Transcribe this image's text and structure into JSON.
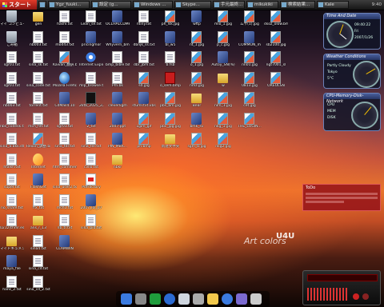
{
  "taskbar": {
    "start_label": "スタート",
    "buttons": [
      "",
      "Ygz_fuuki...",
      "設定 (g...",
      "Windows ...",
      "Skype...",
      "手元最終...",
      "mikukiki",
      "検索結果...",
      "Kale"
    ],
    "clock": "9:40"
  },
  "icons": [
    {
      "label": "マイ コンピュータ",
      "kind": "rec"
    },
    {
      "label": "ごみ箱",
      "kind": "rec"
    },
    {
      "label": "sgr01.txt",
      "kind": "doc"
    },
    {
      "label": "sgr01.txt",
      "kind": "doc"
    },
    {
      "label": "nb003.txt",
      "kind": "doc"
    },
    {
      "label": "nbs_codesk.txt",
      "kind": "doc"
    },
    {
      "label": "sina_a.bkk.stk",
      "kind": "doc"
    },
    {
      "label": "hfalsh.txt",
      "kind": "doc"
    },
    {
      "label": "super.txt",
      "kind": "doc"
    },
    {
      "label": "no_share.txt",
      "kind": "doc"
    },
    {
      "label": "0212(thmr.esp)",
      "kind": "doc"
    },
    {
      "label": "マイドキュメント",
      "kind": "folder"
    },
    {
      "label": "maya_file",
      "kind": "app"
    },
    {
      "label": "hans_2.txt",
      "kind": "doc"
    },
    {
      "label": "gen",
      "kind": "folder"
    },
    {
      "label": "nb003.txt",
      "kind": "doc"
    },
    {
      "label": "sina_sk.txt",
      "kind": "doc"
    },
    {
      "label": "sina_code.txt",
      "kind": "doc"
    },
    {
      "label": "torrent.txt",
      "kind": "doc"
    },
    {
      "label": "mch_fdt.txt",
      "kind": "doc"
    },
    {
      "label": "Rexon_調整.bmp",
      "kind": "img"
    },
    {
      "label": "Internet",
      "kind": "mail"
    },
    {
      "label": "FlashGet",
      "kind": "app"
    },
    {
      "label": "ffx_txt",
      "kind": "doc"
    },
    {
      "label": "ans_r_13",
      "kind": "folder"
    },
    {
      "label": "sina4.txt",
      "kind": "doc"
    },
    {
      "label": "sina_cd.txt",
      "kind": "doc"
    },
    {
      "label": "sina_cd_2.txt",
      "kind": "doc"
    },
    {
      "label": "hashl.txt",
      "kind": "doc"
    },
    {
      "label": "mod43.txt",
      "kind": "doc"
    },
    {
      "label": "Kaivan_翻訳.bmp",
      "kind": "img"
    },
    {
      "label": "Mozilla Firefox",
      "kind": "globe"
    },
    {
      "label": "CdMail4.10",
      "kind": "app"
    },
    {
      "label": "sgr01.txt",
      "kind": "doc"
    },
    {
      "label": "sina_tdr.txt",
      "kind": "doc"
    },
    {
      "label": "hfm_comments",
      "kind": "doc"
    },
    {
      "label": "sina_user2.txt",
      "kind": "doc"
    },
    {
      "label": "mch1.txt",
      "kind": "doc"
    },
    {
      "label": "nb_tr.txt",
      "kind": "doc"
    },
    {
      "label": "CLAMWIN",
      "kind": "app"
    },
    {
      "label": "Lean_se.txt",
      "kind": "doc"
    },
    {
      "label": "pricingmor",
      "kind": "app"
    },
    {
      "label": "Internet Explorer",
      "kind": "ie"
    },
    {
      "label": "mlp_browse.txt",
      "kind": "doc"
    },
    {
      "label": "2ktb_2025_22",
      "kind": "black"
    },
    {
      "label": "2_txt",
      "kind": "app"
    },
    {
      "label": "sina_tdr.txt",
      "kind": "doc"
    },
    {
      "label": "cvllo.txt",
      "kind": "doc"
    },
    {
      "label": "PdfFactory",
      "kind": "pdf"
    },
    {
      "label": "2007_lol_07",
      "kind": "app"
    },
    {
      "label": "sina_pid.txt",
      "kind": "doc"
    },
    {
      "label": "OCLHALCDMF",
      "kind": "app"
    },
    {
      "label": "Whyvern_bm",
      "kind": "app"
    },
    {
      "label": "bmp_bible.txt",
      "kind": "doc"
    },
    {
      "label": "Pm.bk",
      "kind": "doc"
    },
    {
      "label": "cleverkgm",
      "kind": "app"
    },
    {
      "label": "2007.ppt",
      "kind": "app"
    },
    {
      "label": "PIN_MBR...",
      "kind": "app"
    },
    {
      "label": "nbkr",
      "kind": "folder"
    },
    {
      "label": "ntiny.txt",
      "kind": "doc"
    },
    {
      "label": "dbnjk_ss.txt",
      "kind": "doc"
    },
    {
      "label": "dbr_jbm.txt",
      "kind": "doc"
    },
    {
      "label": "sd.jpg",
      "kind": "img"
    },
    {
      "label": "sfuml.txt.vbs",
      "kind": "app"
    },
    {
      "label": "Lgim_gif",
      "kind": "img"
    },
    {
      "label": "ph.bmp",
      "kind": "img"
    },
    {
      "label": "ph_lsk.jpg",
      "kind": "img"
    },
    {
      "label": "bl_w5",
      "kind": "app"
    },
    {
      "label": "b.fsb",
      "kind": "doc"
    },
    {
      "label": "o_sem.bmp",
      "kind": "red"
    },
    {
      "label": "pbs_bm.jpg",
      "kind": "img"
    },
    {
      "label": "pbc_jpg.jpg",
      "kind": "img"
    },
    {
      "label": "新建文件夹",
      "kind": "folder"
    },
    {
      "label": "wftp",
      "kind": "app"
    },
    {
      "label": "nt_1.jpg",
      "kind": "img"
    },
    {
      "label": "o_1.jpg",
      "kind": "img"
    },
    {
      "label": "nmz.jpg",
      "kind": "img"
    },
    {
      "label": "Bear",
      "kind": "folder"
    },
    {
      "label": "bmk_sv",
      "kind": "app"
    },
    {
      "label": "sgm_b.jpg",
      "kind": "img"
    },
    {
      "label": "mio_1.jpg",
      "kind": "img"
    },
    {
      "label": "p_c.jpg",
      "kind": "img"
    },
    {
      "label": "Autoy_SN(%)",
      "kind": "app"
    },
    {
      "label": "w",
      "kind": "folder"
    },
    {
      "label": "nlm_1.jpg",
      "kind": "img"
    },
    {
      "label": "nkg_1.jpg",
      "kind": "img"
    },
    {
      "label": "nkg2.jpg",
      "kind": "img"
    },
    {
      "label": "ムサ(1).jpg",
      "kind": "img"
    },
    {
      "label": "COMMON_m",
      "kind": "app"
    },
    {
      "label": "nn01.jpg",
      "kind": "img"
    },
    {
      "label": "0813.jpg",
      "kind": "img"
    },
    {
      "label": "cet.jpg",
      "kind": "img"
    },
    {
      "label": "THE_LOGIN...",
      "kind": "img"
    },
    {
      "label": "dsoz_olow.bmp",
      "kind": "img"
    },
    {
      "label": "sb2100.jpg",
      "kind": "img"
    },
    {
      "label": "ngt7001_sl",
      "kind": "img"
    },
    {
      "label": "OREOLSN",
      "kind": "img"
    }
  ],
  "gadgets": {
    "time_title": "Time And Date",
    "weather_title": "Weather Conditions",
    "cpu_title": "CPU-Memory-Disk-Network",
    "time_rows": [
      "09:40:22",
      "Fri",
      "2007/1/26"
    ],
    "weather_rows": [
      "Partly Cloudy",
      "Tokyo",
      "5°C"
    ],
    "cpu_rows": [
      "CPU",
      "MEM",
      "DISK"
    ]
  },
  "todo": {
    "title": "ToDo"
  },
  "watermark": "Art colors",
  "brand": "U4U"
}
